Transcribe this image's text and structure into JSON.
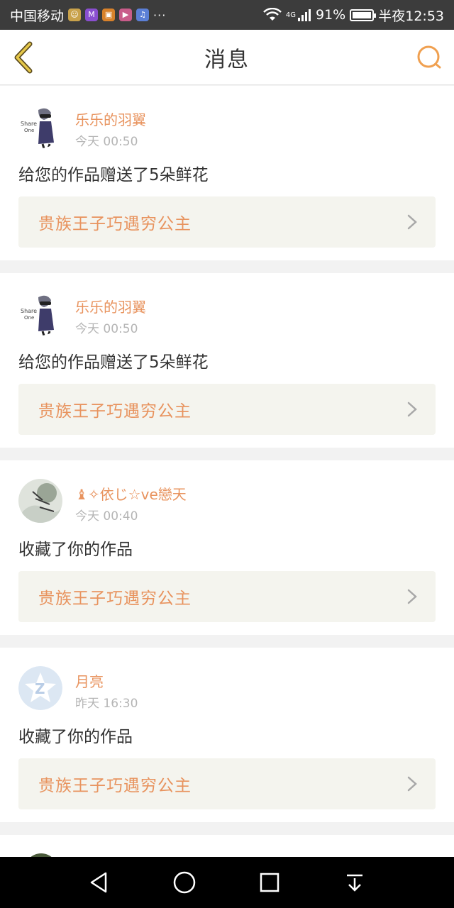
{
  "status_bar": {
    "carrier": "中国移动",
    "dots": "···",
    "network": "4G",
    "battery_percent": "91%",
    "time": "半夜12:53"
  },
  "header": {
    "title": "消息"
  },
  "messages": [
    {
      "user": "乐乐的羽翼",
      "time": "今天 00:50",
      "action": "给您的作品赠送了5朵鲜花",
      "work": "贵族王子巧遇穷公主"
    },
    {
      "user": "乐乐的羽翼",
      "time": "今天 00:50",
      "action": "给您的作品赠送了5朵鲜花",
      "work": "贵族王子巧遇穷公主"
    },
    {
      "user": "♝✧依じ☆ve戀天",
      "time": "今天 00:40",
      "action": "收藏了你的作品",
      "work": "贵族王子巧遇穷公主"
    },
    {
      "user": "月亮",
      "time": "昨天 16:30",
      "action": "收藏了你的作品",
      "work": "贵族王子巧遇穷公主"
    }
  ],
  "colors": {
    "accent": "#e8935e",
    "status_bar_bg": "#3c3c3c",
    "page_bg": "#f2f2f2",
    "work_card_bg": "#f4f4ee"
  },
  "icons": {
    "back": "chevron-left-icon",
    "search": "search-icon",
    "work_arrow": "chevron-right-icon",
    "nav_back": "triangle-back-icon",
    "nav_home": "circle-home-icon",
    "nav_recent": "square-recent-icon",
    "nav_menu": "dropdown-menu-icon"
  }
}
